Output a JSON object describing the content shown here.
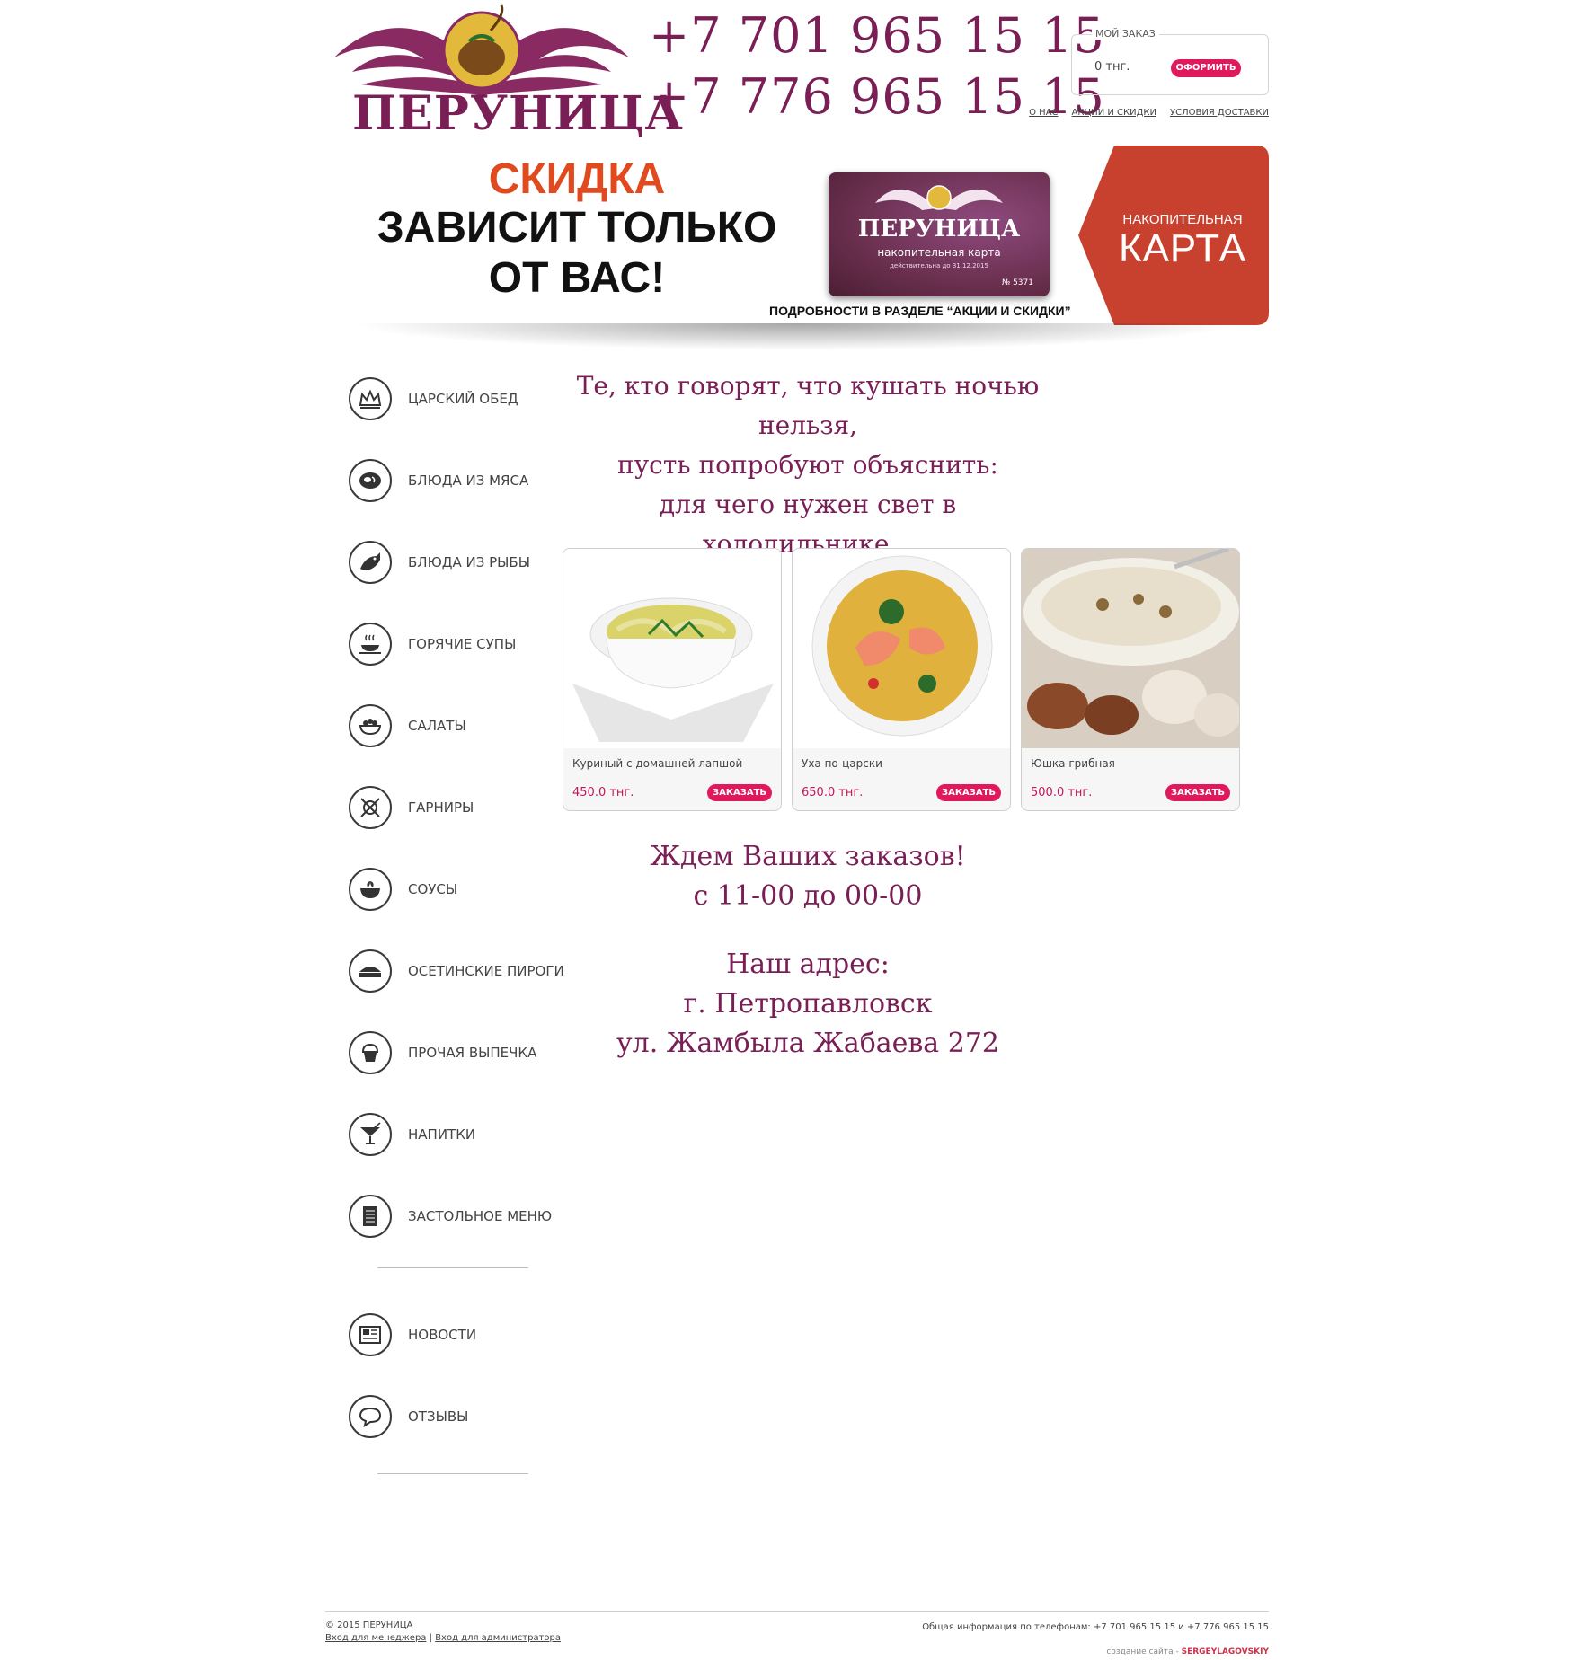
{
  "header": {
    "logo_text": "ПЕРУНИЦА",
    "phones": [
      "+7 701 965 15 15",
      "+7 776 965 15 15"
    ],
    "order": {
      "legend": "МОЙ ЗАКАЗ",
      "sum": "0 тнг.",
      "checkout_label": "ОФОРМИТЬ"
    },
    "links": [
      "О НАС",
      "АКЦИИ И СКИДКИ",
      "УСЛОВИЯ ДОСТАВКИ"
    ]
  },
  "banner": {
    "line1": "СКИДКА",
    "line2": "ЗАВИСИТ ТОЛЬКО",
    "line3": "ОТ ВАС!",
    "note": "ПОДРОБНОСТИ В РАЗДЕЛЕ “АКЦИИ И СКИДКИ”",
    "card": {
      "name": "ПЕРУНИЦА",
      "subtitle": "накопительная карта",
      "valid": "действительна до 31.12.2015",
      "number": "№ 5371"
    },
    "tag": {
      "small": "НАКОПИТЕЛЬНАЯ",
      "big": "КАРТА"
    }
  },
  "menu": {
    "categories": [
      {
        "label": "ЦАРСКИЙ ОБЕД",
        "icon": "crown-icon"
      },
      {
        "label": "БЛЮДА ИЗ МЯСА",
        "icon": "meat-icon"
      },
      {
        "label": "БЛЮДА ИЗ РЫБЫ",
        "icon": "fish-icon"
      },
      {
        "label": "ГОРЯЧИЕ СУПЫ",
        "icon": "hot-soup-icon"
      },
      {
        "label": "САЛАТЫ",
        "icon": "salad-icon"
      },
      {
        "label": "ГАРНИРЫ",
        "icon": "fork-knife-icon"
      },
      {
        "label": "СОУСЫ",
        "icon": "sauce-bowl-icon"
      },
      {
        "label": "ОСЕТИНСКИЕ ПИРОГИ",
        "icon": "pie-icon"
      },
      {
        "label": "ПРОЧАЯ ВЫПЕЧКА",
        "icon": "cupcake-icon"
      },
      {
        "label": "НАПИТКИ",
        "icon": "cocktail-icon"
      },
      {
        "label": "ЗАСТОЛЬНОЕ МЕНЮ",
        "icon": "menu-book-icon"
      }
    ],
    "extra": [
      {
        "label": "НОВОСТИ",
        "icon": "newspaper-icon"
      },
      {
        "label": "ОТЗЫВЫ",
        "icon": "speech-bubble-icon"
      }
    ]
  },
  "main": {
    "quote": [
      "Те, кто говорят, что кушать ночью нельзя,",
      "пусть попробуют объяснить:",
      "для чего нужен свет в холодильнике..."
    ],
    "products": [
      {
        "name": "Куриный с домашней лапшой",
        "price": "450.0 тнг.",
        "button": "ЗАКАЗАТЬ"
      },
      {
        "name": "Уха по-царски",
        "price": "650.0 тнг.",
        "button": "ЗАКАЗАТЬ"
      },
      {
        "name": "Юшка грибная",
        "price": "500.0 тнг.",
        "button": "ЗАКАЗАТЬ"
      }
    ],
    "wait": [
      "Ждем Ваших заказов!",
      "с 11-00 до 00-00"
    ],
    "address": [
      "Наш адрес:",
      "г. Петропавловск",
      "ул. Жамбыла Жабаева 272"
    ]
  },
  "footer": {
    "copyright": "© 2015 ПЕРУНИЦА",
    "manager_link": "Вход для менеджера",
    "separator": "|",
    "admin_link": "Вход для администратора",
    "phones_info": "Общая информация по телефонам: +7 701 965 15 15 и +7 776 965 15 15",
    "credit_prefix": "создание сайта -",
    "credit_name": "SERGEYLAGOVSKIY"
  },
  "colors": {
    "brand": "#7a1f55",
    "accent": "#e0195d",
    "banner_red": "#c8412f",
    "price": "#c2185b"
  }
}
